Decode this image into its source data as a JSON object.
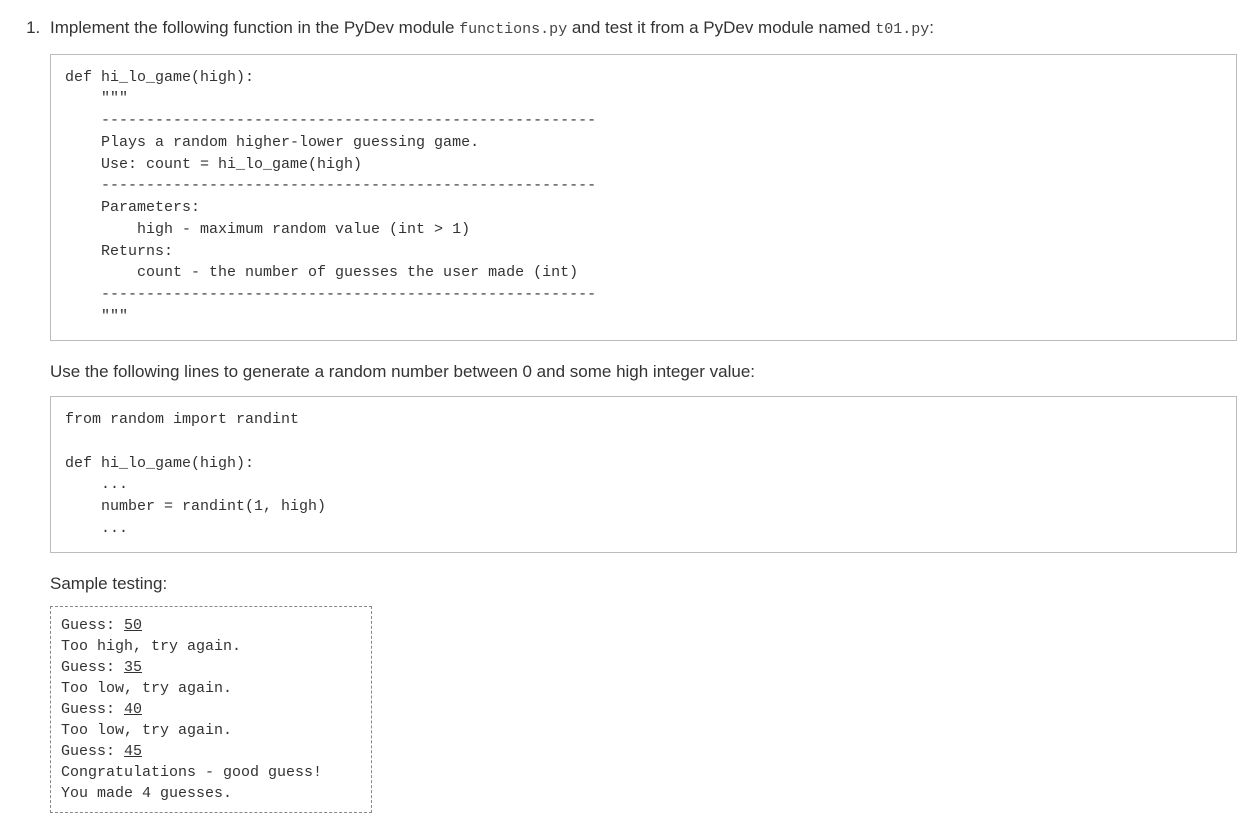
{
  "intro": {
    "prefix": "Implement the following function in the PyDev module ",
    "code1": "functions.py",
    "mid": " and test it from a PyDev module named ",
    "code2": "t01.py",
    "suffix": ":"
  },
  "code_block_1": "def hi_lo_game(high):\n    \"\"\"\n    -------------------------------------------------------\n    Plays a random higher-lower guessing game.\n    Use: count = hi_lo_game(high)\n    -------------------------------------------------------\n    Parameters:\n        high - maximum random value (int > 1)\n    Returns:\n        count - the number of guesses the user made (int)\n    -------------------------------------------------------\n    \"\"\"",
  "mid_text": "Use the following lines to generate a random number between 0 and some high integer value:",
  "code_block_2": "from random import randint\n\ndef hi_lo_game(high):\n    ...\n    number = randint(1, high)\n    ...",
  "sample_heading": "Sample testing:",
  "sample": {
    "lines": [
      {
        "prompt": "Guess: ",
        "input": "50"
      },
      {
        "text": "Too high, try again."
      },
      {
        "prompt": "Guess: ",
        "input": "35"
      },
      {
        "text": "Too low, try again."
      },
      {
        "prompt": "Guess: ",
        "input": "40"
      },
      {
        "text": "Too low, try again."
      },
      {
        "prompt": "Guess: ",
        "input": "45"
      },
      {
        "text": "Congratulations - good guess!"
      },
      {
        "text": "You made 4 guesses."
      }
    ]
  }
}
